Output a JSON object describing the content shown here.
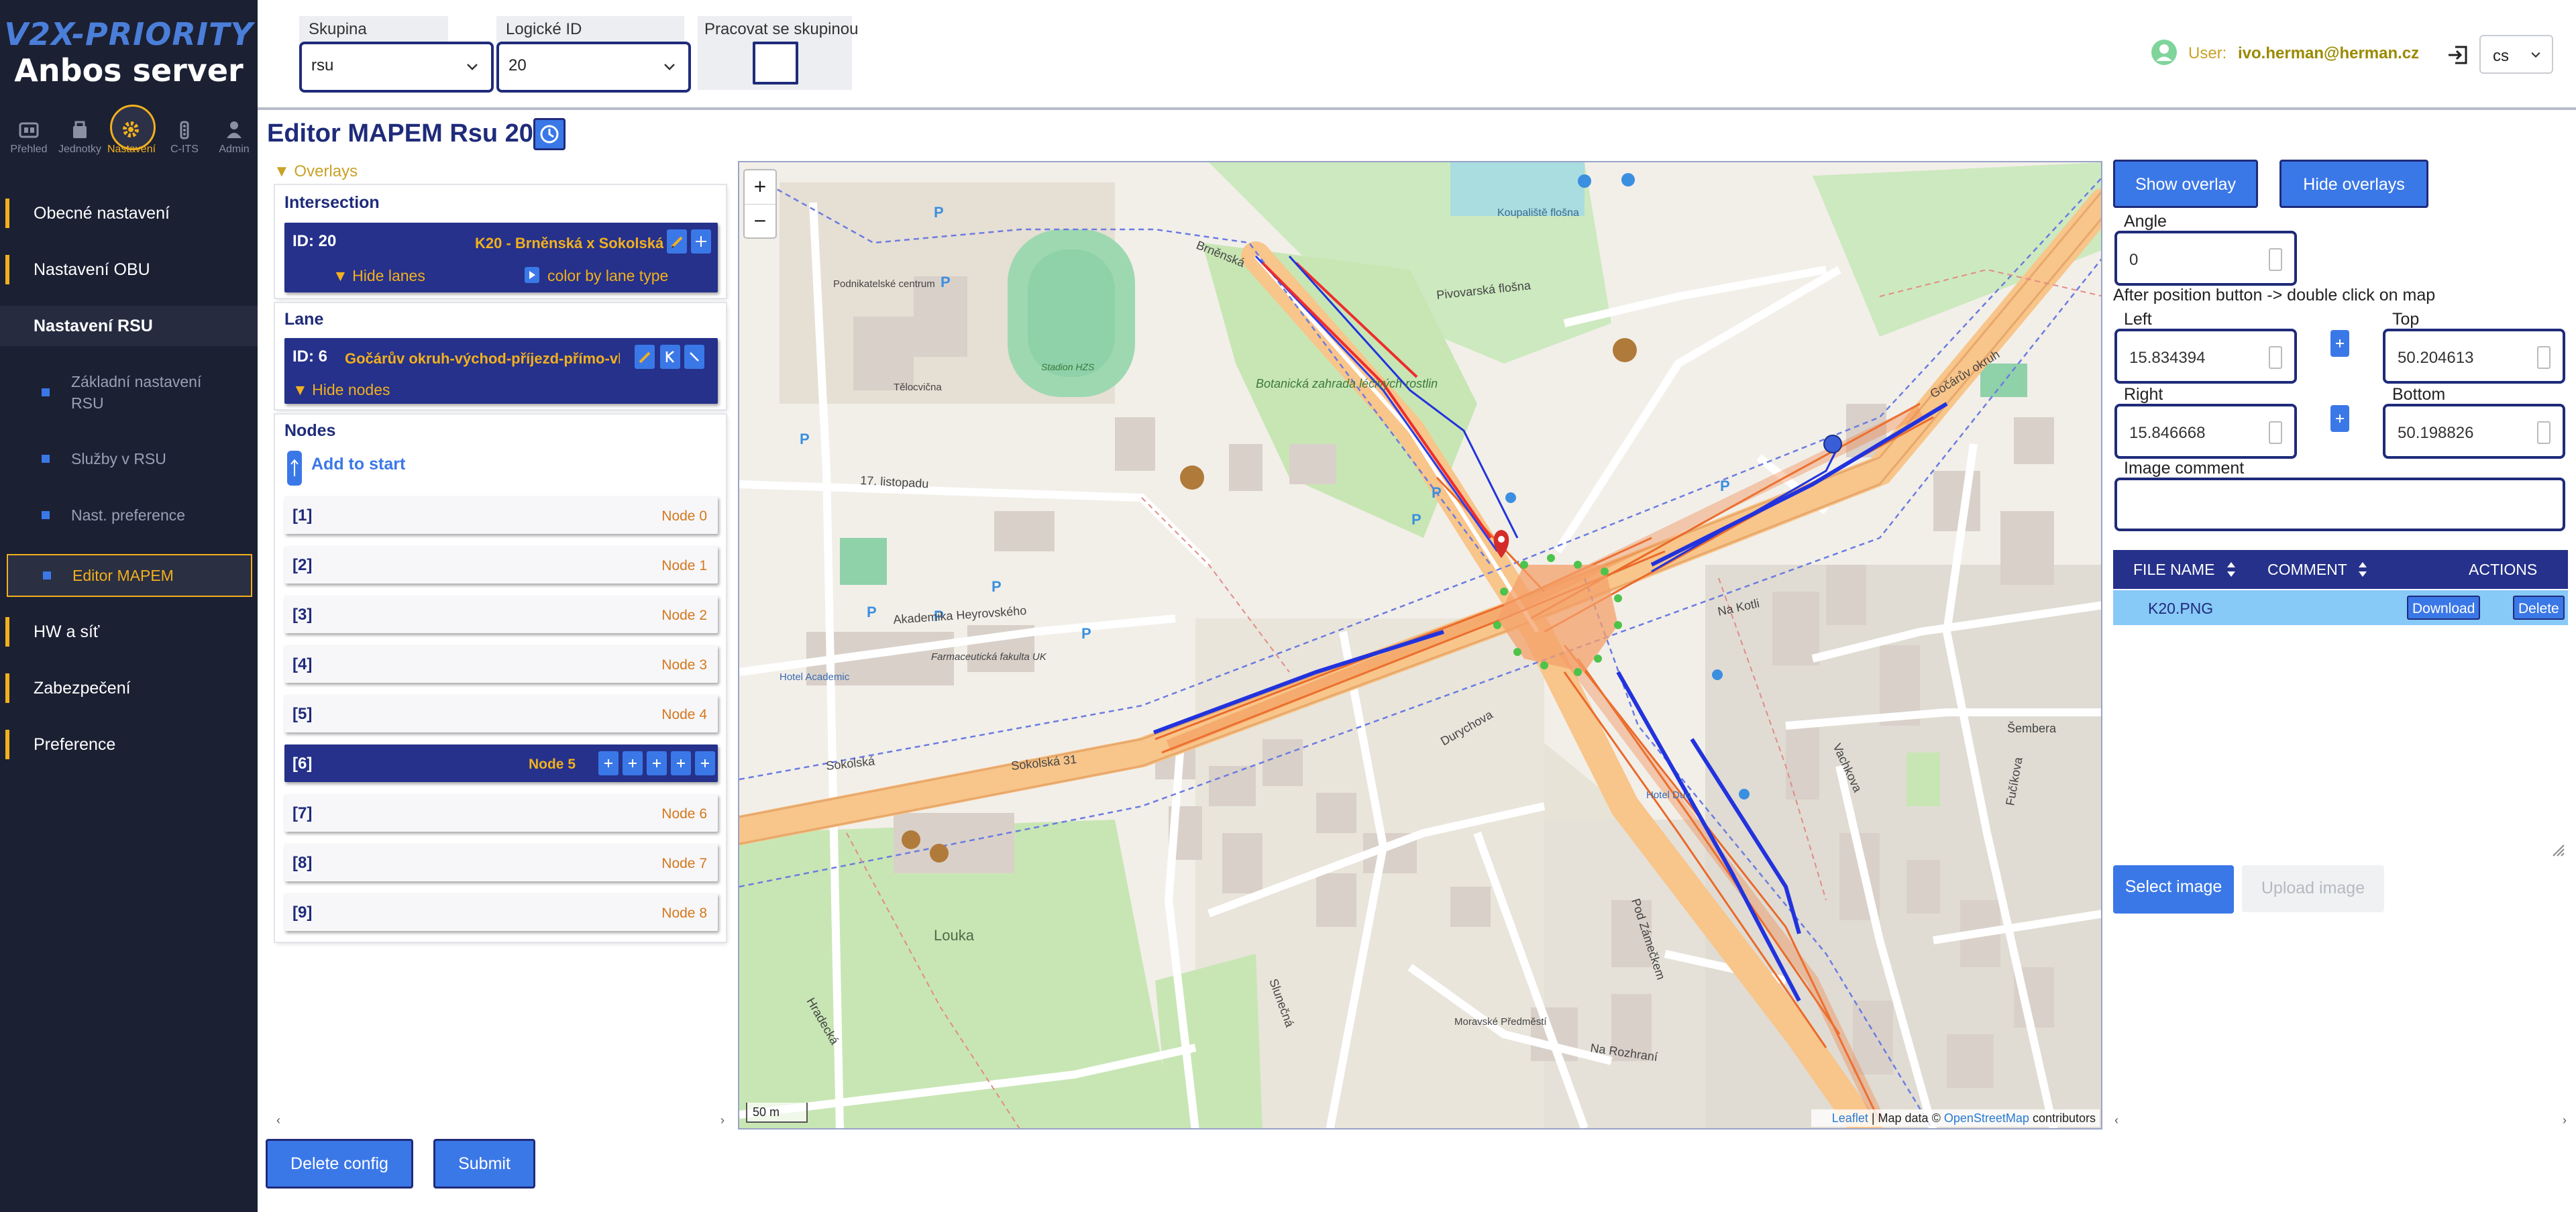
{
  "brand": {
    "logo": "V2X-PRIORITY",
    "name": "Anbos server"
  },
  "topnav": [
    {
      "label": "Přehled",
      "icon": "overview-icon"
    },
    {
      "label": "Jednotky",
      "icon": "units-icon"
    },
    {
      "label": "Nastavení",
      "icon": "gear-icon"
    },
    {
      "label": "C-ITS",
      "icon": "cits-icon"
    },
    {
      "label": "Admin",
      "icon": "admin-icon"
    }
  ],
  "menu": {
    "general": "Obecné nastavení",
    "obu": "Nastavení OBU",
    "rsu": "Nastavení RSU",
    "sub": [
      "Základní nastavení RSU",
      "Služby v RSU",
      "Nast. preference",
      "Editor MAPEM"
    ],
    "hw": "HW a síť",
    "security": "Zabezpečení",
    "preference": "Preference"
  },
  "header": {
    "group_label": "Skupina",
    "group_value": "rsu",
    "logic_label": "Logické ID",
    "logic_value": "20",
    "work_label": "Pracovat se skupinou",
    "user_label": "User:",
    "user_email": "ivo.herman@herman.cz",
    "lang": "cs"
  },
  "title": "Editor MAPEM Rsu 20",
  "overlays_label": "Overlays",
  "intersection": {
    "heading": "Intersection",
    "id": "ID: 20",
    "name": "K20 - Brněnská x Sokolská",
    "hide_lanes": "Hide lanes",
    "color_by": "color by lane type"
  },
  "lane": {
    "heading": "Lane",
    "id": "ID: 6",
    "name": "Gočárův okruh-východ-příjezd-přímo-vl...",
    "hide_nodes": "Hide nodes"
  },
  "nodes": {
    "heading": "Nodes",
    "add_label": "Add to start",
    "items": [
      {
        "idx": "[1]",
        "name": "Node 0"
      },
      {
        "idx": "[2]",
        "name": "Node 1"
      },
      {
        "idx": "[3]",
        "name": "Node 2"
      },
      {
        "idx": "[4]",
        "name": "Node 3"
      },
      {
        "idx": "[5]",
        "name": "Node 4"
      },
      {
        "idx": "[6]",
        "name": "Node 5"
      },
      {
        "idx": "[7]",
        "name": "Node 6"
      },
      {
        "idx": "[8]",
        "name": "Node 7"
      },
      {
        "idx": "[9]",
        "name": "Node 8"
      }
    ]
  },
  "buttons": {
    "delete_config": "Delete config",
    "submit": "Submit"
  },
  "map": {
    "scale": "50 m",
    "attribution_leaflet": "Leaflet",
    "attribution_mid": "| Map data ©",
    "attribution_osm": "OpenStreetMap",
    "attribution_end": "contributors",
    "labels": [
      "Brněnská",
      "Pivovarská flošna",
      "Gočárův okruh",
      "17. listopadu",
      "Akademika Heyrovského",
      "Sokolská",
      "Botanická zahrada léčivých rostlin",
      "Na Kotli",
      "Vachkova",
      "Durychova",
      "Louka",
      "Slunečná",
      "Hradecká",
      "Na Rozhraní",
      "Pod Zámečkem",
      "Šembera",
      "Fučíkova",
      "Koupaliště flošna",
      "Stadion HZS",
      "Podnikatelské centrum",
      "Tělocvična",
      "Hotel Academic",
      "Farmaceutická fakulta UK",
      "Moravské Předměstí",
      "Hotel Duo",
      "Sokolská 31"
    ]
  },
  "right": {
    "show_overlay": "Show overlay",
    "hide_overlays": "Hide overlays",
    "angle_label": "Angle",
    "angle_value": "0",
    "hint": "After position button -> double click on map",
    "left_label": "Left",
    "left_value": "15.834394",
    "top_label": "Top",
    "top_value": "50.204613",
    "right_label": "Right",
    "right_value": "15.846668",
    "bottom_label": "Bottom",
    "bottom_value": "50.198826",
    "comment_label": "Image comment",
    "table": {
      "col_file": "FILE NAME",
      "col_comment": "COMMENT",
      "col_actions": "ACTIONS",
      "rows": [
        {
          "file": "K20.PNG",
          "download": "Download",
          "delete": "Delete"
        }
      ]
    },
    "select_image": "Select image",
    "upload_image": "Upload image"
  },
  "colors": {
    "sidebar": "#1b2033",
    "accent": "#f2b01e",
    "primary": "#3b78e7",
    "navy": "#1f2b7a"
  }
}
